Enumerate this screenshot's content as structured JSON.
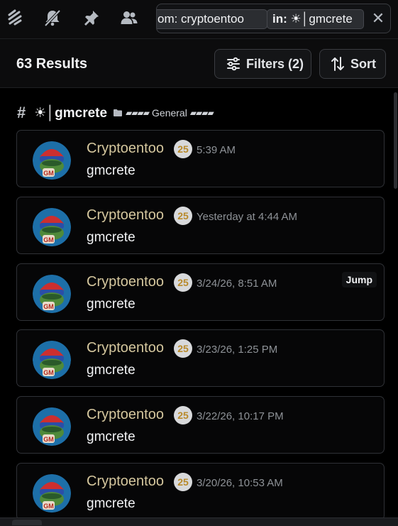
{
  "toolbar": {
    "icons": [
      "threads-icon",
      "bell-muted-icon",
      "pin-icon",
      "members-icon"
    ]
  },
  "search": {
    "chips": [
      {
        "key": "from:",
        "value": "cryptoentoo",
        "visible_text": "om: cryptoentoo"
      },
      {
        "key": "in:",
        "value": "☀│gmcrete",
        "visible_key": "in:",
        "visible_value": "☀│gmcrete"
      }
    ],
    "clear_icon": "close-icon"
  },
  "results": {
    "count_label": "63 Results",
    "filters_label": "Filters (2)",
    "sort_label": "Sort"
  },
  "channel": {
    "hash": "#",
    "name": "☀│gmcrete",
    "bars_left": "▰▰▰▰",
    "category": "General",
    "bars_right": "▰▰▰▰"
  },
  "messages": [
    {
      "author": "Cryptoentoo",
      "badge": "25",
      "time": "5:39 AM",
      "content": "gmcrete"
    },
    {
      "author": "Cryptoentoo",
      "badge": "25",
      "time": "Yesterday at 4:44 AM",
      "content": "gmcrete"
    },
    {
      "author": "Cryptoentoo",
      "badge": "25",
      "time": "3/24/26, 8:51 AM",
      "content": "gmcrete",
      "jump_label": "Jump"
    },
    {
      "author": "Cryptoentoo",
      "badge": "25",
      "time": "3/23/26, 1:25 PM",
      "content": "gmcrete"
    },
    {
      "author": "Cryptoentoo",
      "badge": "25",
      "time": "3/22/26, 10:17 PM",
      "content": "gmcrete"
    },
    {
      "author": "Cryptoentoo",
      "badge": "25",
      "time": "3/20/26, 10:53 AM",
      "content": "gmcrete"
    }
  ],
  "colors": {
    "background": "#000000",
    "panel": "#0c0c0d",
    "card_border": "#2f3136",
    "author_name": "#d5c79e",
    "badge_bg": "#d8d9db",
    "badge_text": "#b8892a",
    "timestamp": "#8e9297"
  }
}
